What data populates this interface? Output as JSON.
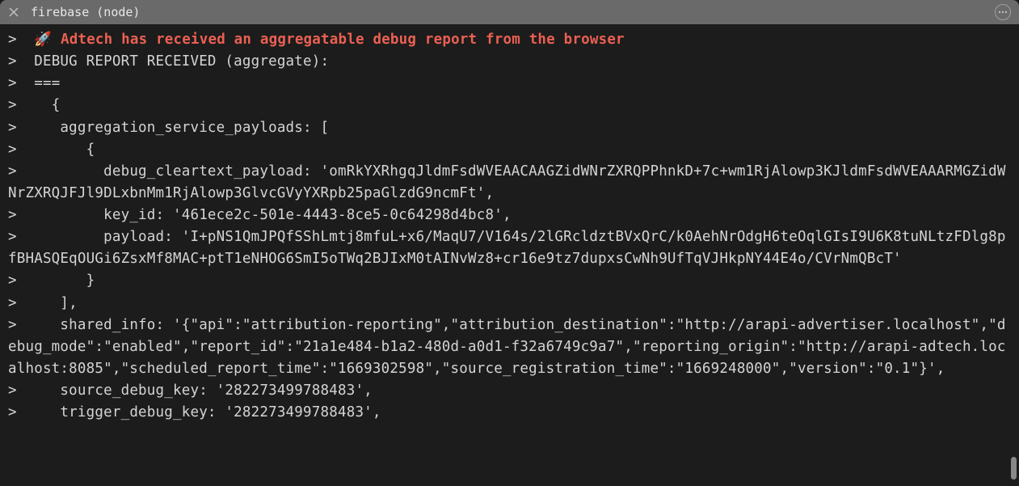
{
  "tab": {
    "title": "firebase (node)"
  },
  "terminal": {
    "prompt": ">",
    "lines": [
      {
        "prefix": ">  ",
        "style": "highlight",
        "prepend_emoji": "🚀",
        "content": " Adtech has received an aggregatable debug report from the browser"
      },
      {
        "prefix": ">  ",
        "style": "text",
        "content": "DEBUG REPORT RECEIVED (aggregate):"
      },
      {
        "prefix": ">  ",
        "style": "text",
        "content": "==="
      },
      {
        "prefix": ">  ",
        "style": "text",
        "content": "  {"
      },
      {
        "prefix": ">  ",
        "style": "text",
        "content": "   aggregation_service_payloads: ["
      },
      {
        "prefix": ">  ",
        "style": "text",
        "content": "      {"
      },
      {
        "prefix": ">  ",
        "style": "text",
        "content": "        debug_cleartext_payload: 'omRkYXRhgqJldmFsdWVEAACAAGZidWNrZXRQPPhnkD+7c+wm1RjAlowp3KJldmFsdWVEAAARMGZidWNrZXRQJFJl9DLxbnMm1RjAlowp3GlvcGVyYXRpb25paGlzdG9ncmFt',"
      },
      {
        "prefix": ">  ",
        "style": "text",
        "content": "        key_id: '461ece2c-501e-4443-8ce5-0c64298d4bc8',"
      },
      {
        "prefix": ">  ",
        "style": "text",
        "content": "        payload: 'I+pNS1QmJPQfSShLmtj8mfuL+x6/MaqU7/V164s/2lGRcldztBVxQrC/k0AehNrOdgH6teOqlGIsI9U6K8tuNLtzFDlg8pfBHASQEqOUGi6ZsxMf8MAC+ptT1eNHOG6SmI5oTWq2BJIxM0tAINvWz8+cr16e9tz7dupxsCwNh9UfTqVJHkpNY44E4o/CVrNmQBcT'"
      },
      {
        "prefix": ">  ",
        "style": "text",
        "content": "      }"
      },
      {
        "prefix": ">  ",
        "style": "text",
        "content": "   ],"
      },
      {
        "prefix": ">  ",
        "style": "text",
        "content": "   shared_info: '{\"api\":\"attribution-reporting\",\"attribution_destination\":\"http://arapi-advertiser.localhost\",\"debug_mode\":\"enabled\",\"report_id\":\"21a1e484-b1a2-480d-a0d1-f32a6749c9a7\",\"reporting_origin\":\"http://arapi-adtech.localhost:8085\",\"scheduled_report_time\":\"1669302598\",\"source_registration_time\":\"1669248000\",\"version\":\"0.1\"}',"
      },
      {
        "prefix": ">  ",
        "style": "text",
        "content": "   source_debug_key: '282273499788483',"
      },
      {
        "prefix": ">  ",
        "style": "text",
        "content": "   trigger_debug_key: '282273499788483',"
      }
    ]
  }
}
